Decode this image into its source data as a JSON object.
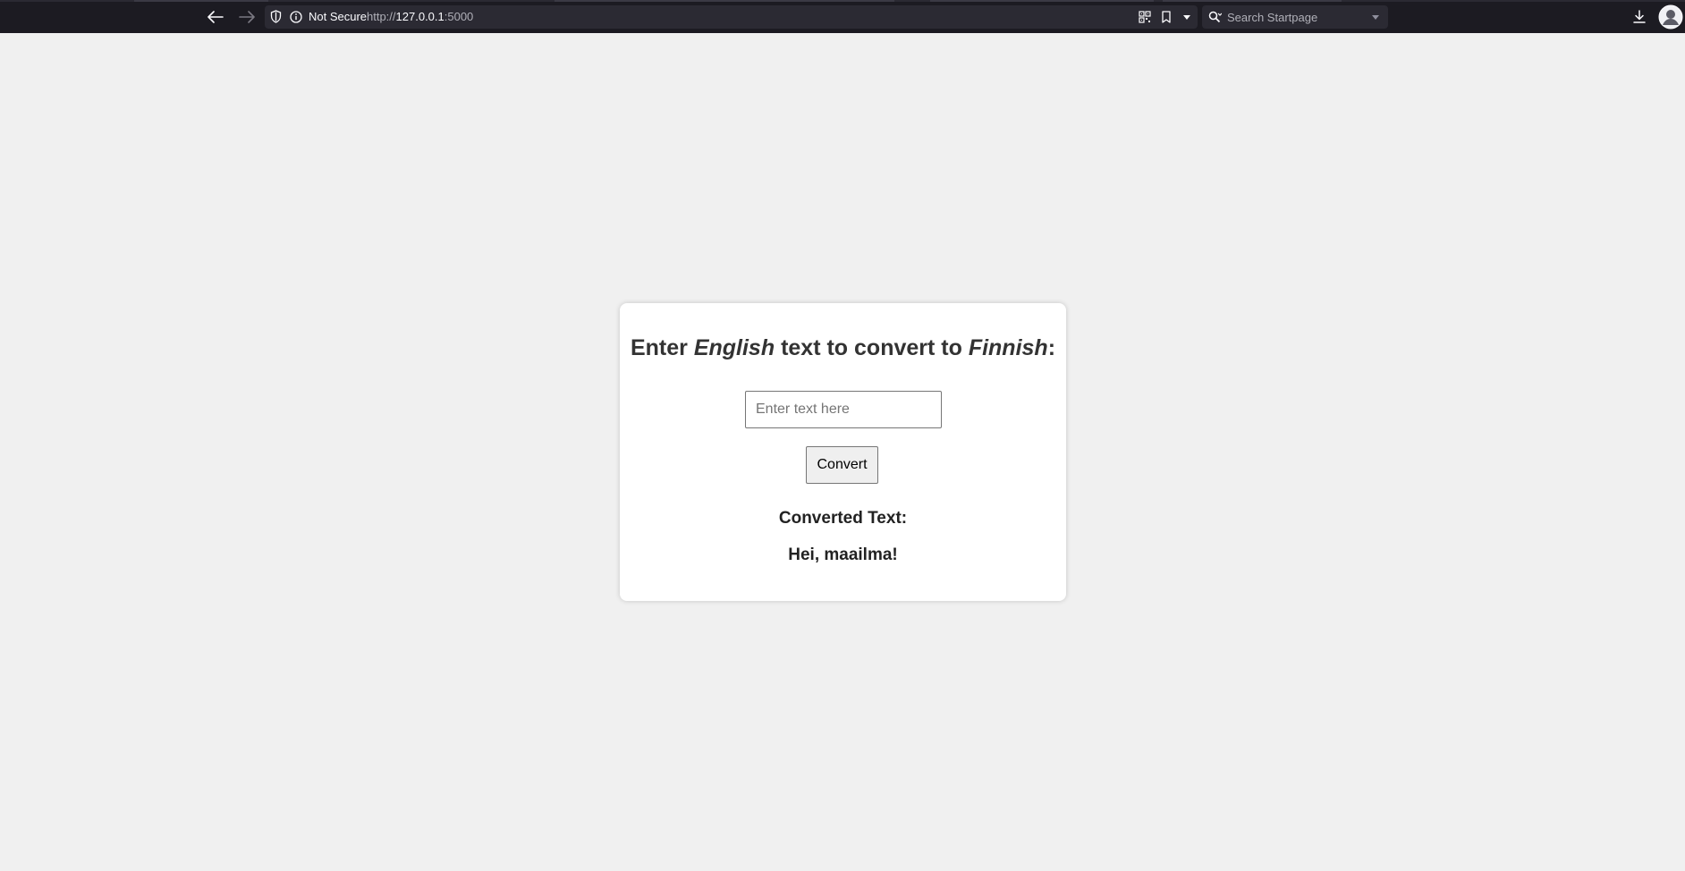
{
  "browser": {
    "security_label": "Not Secure",
    "url_scheme": "http://",
    "url_host": "127.0.0.1",
    "url_port": ":5000",
    "search_placeholder": "Search Startpage"
  },
  "page": {
    "heading_prefix": "Enter ",
    "heading_lang_from": "English",
    "heading_middle": " text to convert to ",
    "heading_lang_to": "Finnish",
    "heading_suffix": ":",
    "input_placeholder": "Enter text here",
    "input_value": "",
    "convert_label": "Convert",
    "result_label": "Converted Text:",
    "result_value": "Hei, maailma!"
  },
  "colors": {
    "chrome_bg": "#1c1b22",
    "url_field_bg": "#2b2a33",
    "page_bg": "#f0f0f0",
    "card_bg": "#ffffff",
    "text": "#333333"
  }
}
